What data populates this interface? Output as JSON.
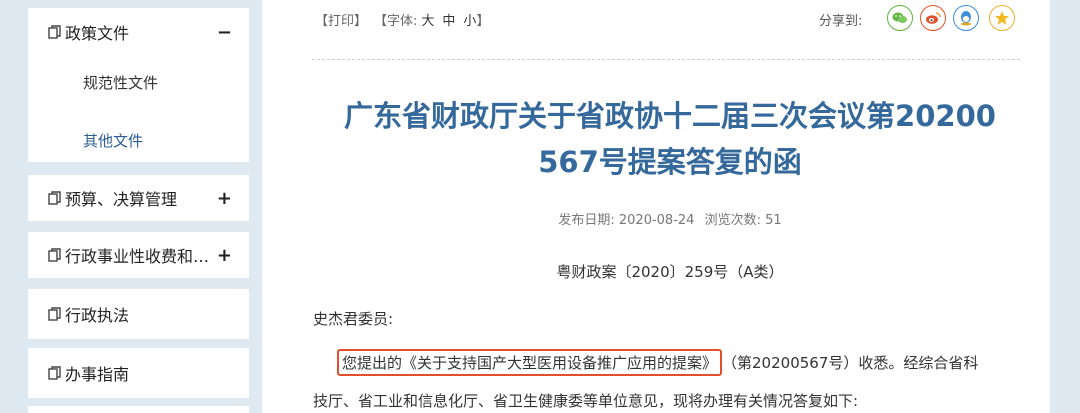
{
  "sidebar": {
    "section1": {
      "label": "政策文件",
      "toggle": "−",
      "items": [
        "规范性文件",
        "其他文件"
      ]
    },
    "nav": [
      {
        "label": "预算、决算管理",
        "toggle": "+"
      },
      {
        "label": "行政事业性收费和…",
        "toggle": "+"
      },
      {
        "label": "行政执法",
        "toggle": ""
      },
      {
        "label": "办事指南",
        "toggle": ""
      }
    ]
  },
  "toolbar": {
    "print": "【打印】",
    "font_prefix": "【字体:",
    "font_large": "大",
    "font_medium": "中",
    "font_small": "小",
    "font_suffix": "】",
    "share_label": "分享到:"
  },
  "share_icons": [
    "wechat-icon",
    "weibo-icon",
    "qq-icon",
    "qzone-icon"
  ],
  "colors": {
    "title": "#35699c",
    "highlight_border": "#e0502c",
    "sidebar_bg": "#dfe9f2",
    "active_link": "#2a5d94"
  },
  "article": {
    "title_line1": "广东省财政厅关于省政协十二届三次会议第20200",
    "title_line2": "567号提案答复的函",
    "meta_date_label": "发布日期:",
    "meta_date": "2020-08-24",
    "meta_views_label": "浏览次数:",
    "meta_views": "51",
    "doc_number": "粤财政案〔2020〕259号（A类）",
    "greeting": "史杰君委员:",
    "para_highlight": "您提出的《关于支持国产大型医用设备推广应用的提案》",
    "para_rest": "（第20200567号）收悉。经综合省科",
    "para_line2": "技厅、省工业和信息化厅、省卫生健康委等单位意见，现将办理有关情况答复如下:"
  }
}
